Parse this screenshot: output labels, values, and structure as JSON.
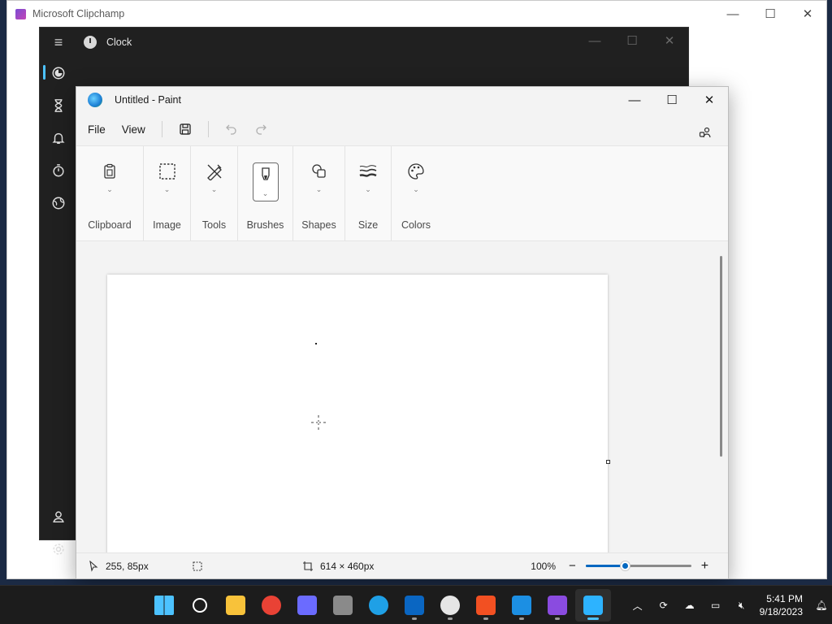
{
  "clipchamp": {
    "title": "Microsoft Clipchamp"
  },
  "clock_app": {
    "title": "Clock",
    "nav": [
      {
        "name": "focus-sessions",
        "icon": "focus-icon"
      },
      {
        "name": "timer",
        "icon": "hourglass-icon"
      },
      {
        "name": "alarm",
        "icon": "bell-icon"
      },
      {
        "name": "stopwatch",
        "icon": "stopwatch-icon"
      },
      {
        "name": "world-clock",
        "icon": "globe-icon"
      }
    ]
  },
  "paint": {
    "title": "Untitled - Paint",
    "menu": {
      "file": "File",
      "view": "View"
    },
    "ribbon": {
      "clipboard": "Clipboard",
      "image": "Image",
      "tools": "Tools",
      "brushes": "Brushes",
      "shapes": "Shapes",
      "size": "Size",
      "colors": "Colors"
    },
    "status": {
      "cursor_pos": "255, 85px",
      "canvas_size": "614 × 460px",
      "zoom": "100%",
      "zoom_fraction": 0.37
    }
  },
  "taskbar": {
    "apps": [
      {
        "name": "start",
        "icon": "windows-icon",
        "color": "#4cc2ff",
        "running": false
      },
      {
        "name": "search",
        "icon": "search-icon",
        "color": "#ffffff",
        "running": false
      },
      {
        "name": "file-explorer",
        "icon": "folder-icon",
        "color": "#f8c23a",
        "running": false
      },
      {
        "name": "chrome",
        "icon": "chrome-icon",
        "color": "#e94235",
        "running": false
      },
      {
        "name": "copilot",
        "icon": "copilot-icon",
        "color": "#6b6bff",
        "running": false
      },
      {
        "name": "calculator",
        "icon": "calculator-icon",
        "color": "#8a8a8a",
        "running": false
      },
      {
        "name": "edge",
        "icon": "edge-icon",
        "color": "#1fa0e6",
        "running": false
      },
      {
        "name": "linkedin",
        "icon": "linkedin-icon",
        "color": "#0a66c2",
        "running": true
      },
      {
        "name": "clock",
        "icon": "clock-icon",
        "color": "#e5e5e5",
        "running": true
      },
      {
        "name": "store",
        "icon": "store-icon",
        "color": "#f25022",
        "running": true
      },
      {
        "name": "mail",
        "icon": "mail-icon",
        "color": "#1c8fe3",
        "running": true
      },
      {
        "name": "clipchamp",
        "icon": "clipchamp-icon",
        "color": "#8a4be0",
        "running": true
      },
      {
        "name": "paint",
        "icon": "paint-icon",
        "color": "#2db3ff",
        "running": true,
        "active": true
      }
    ],
    "time": "5:41 PM",
    "date": "9/18/2023"
  }
}
